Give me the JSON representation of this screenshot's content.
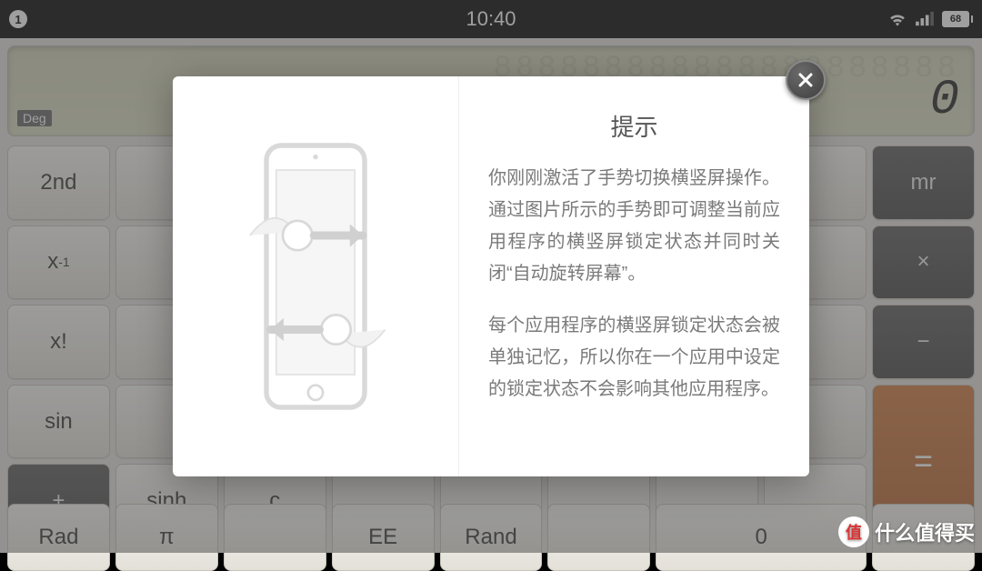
{
  "status": {
    "indicator": "1",
    "time": "10:40",
    "battery": "68"
  },
  "calc": {
    "mode": "Deg",
    "value": "0",
    "rows": [
      [
        "2nd",
        "",
        "",
        "",
        "",
        "",
        "",
        "",
        "mr"
      ],
      [
        "x⁻¹",
        "",
        "",
        "",
        "",
        "",
        "",
        "",
        "×"
      ],
      [
        "x!",
        "",
        "",
        "",
        "",
        "",
        "",
        "",
        "−"
      ],
      [
        "sin",
        "",
        "",
        "",
        "",
        "",
        "",
        "",
        "+"
      ],
      [
        "sinh",
        "c",
        "",
        "",
        "",
        "",
        "",
        "",
        ""
      ],
      [
        "Rad",
        "π",
        "",
        "EE",
        "Rand",
        "",
        "0",
        "",
        "="
      ]
    ]
  },
  "dialog": {
    "title": "提示",
    "p1": "你刚刚激活了手势切换横竖屏操作。通过图片所示的手势即可调整当前应用程序的横竖屏锁定状态并同时关闭“自动旋转屏幕”。",
    "p2": "每个应用程序的横竖屏锁定状态会被单独记忆，所以你在一个应用中设定的锁定状态不会影响其他应用程序。"
  },
  "watermark": {
    "badge": "值",
    "text": "什么值得买"
  }
}
